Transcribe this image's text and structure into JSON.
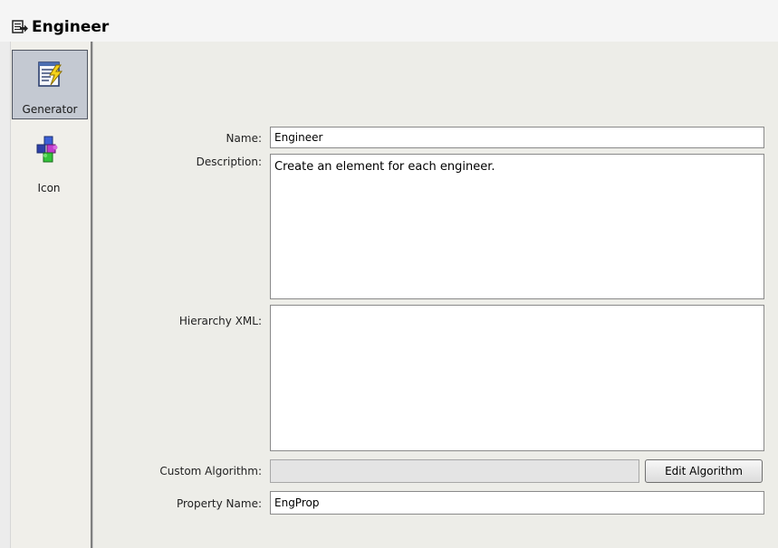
{
  "header": {
    "title": "Engineer",
    "icon": "generator-document-icon"
  },
  "sidebar": {
    "items": [
      {
        "label": "Generator",
        "icon": "generator-icon",
        "selected": true
      },
      {
        "label": "Icon",
        "icon": "icon-puzzle-icon",
        "selected": false
      }
    ]
  },
  "form": {
    "name": {
      "label": "Name:",
      "value": "Engineer"
    },
    "description": {
      "label": "Description:",
      "value": "Create an element for each engineer."
    },
    "hierarchy_xml": {
      "label": "Hierarchy XML:",
      "value": ""
    },
    "custom_algorithm": {
      "label": "Custom Algorithm:",
      "value": "",
      "button_label": "Edit Algorithm"
    },
    "property_name": {
      "label": "Property Name:",
      "value": "EngProp"
    }
  },
  "colors": {
    "selected_bg": "#c4c9d2",
    "panel_bg": "#edede8",
    "sidebar_bg": "#f0efea"
  }
}
